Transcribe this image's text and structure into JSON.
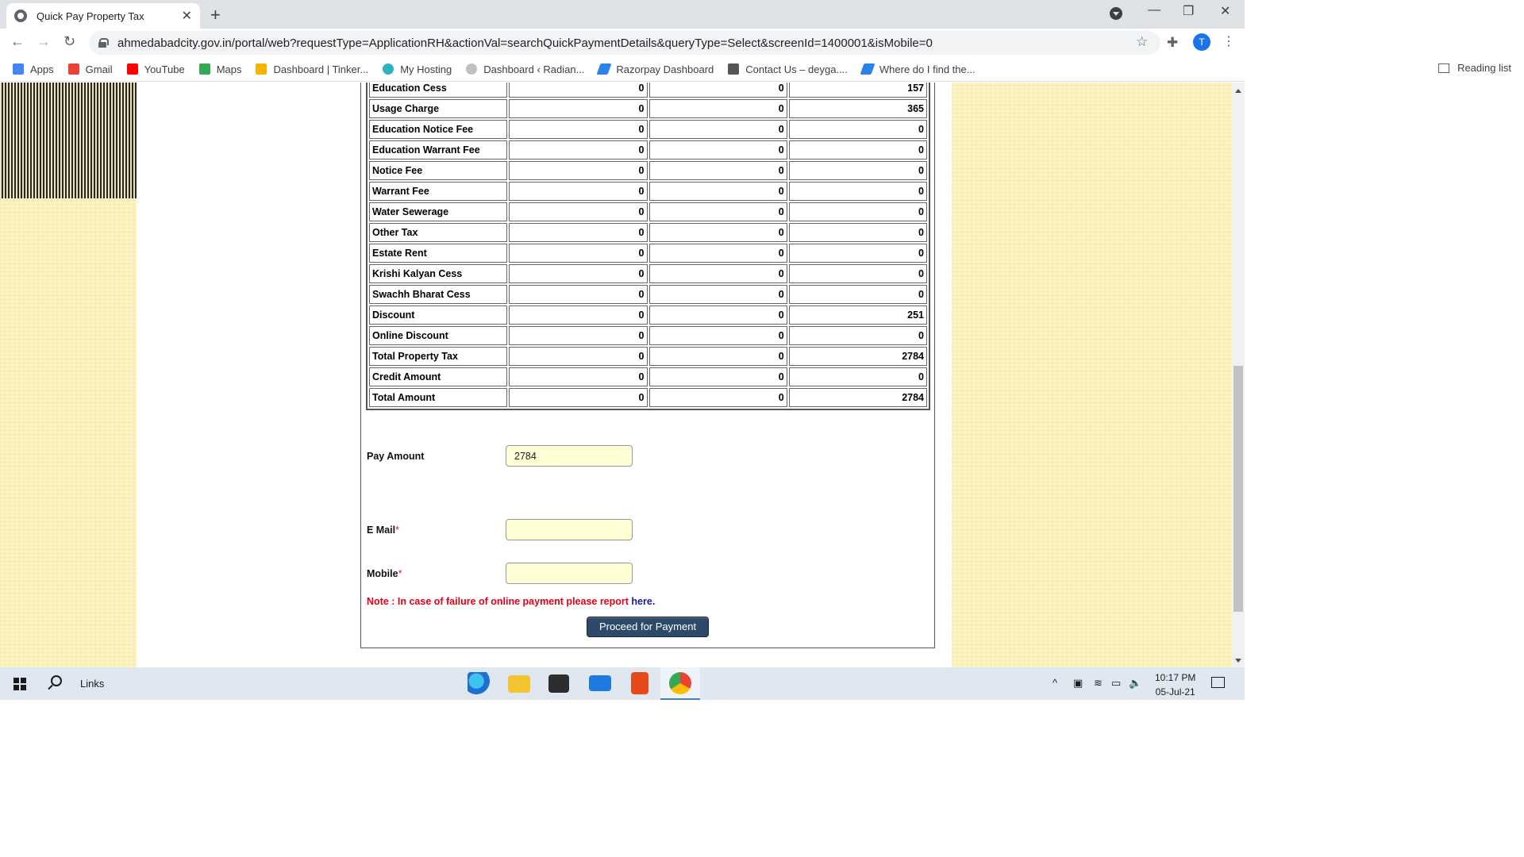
{
  "browser": {
    "tab_title": "Quick Pay Property Tax",
    "url": "ahmedabadcity.gov.in/portal/web?requestType=ApplicationRH&actionVal=searchQuickPaymentDetails&queryType=Select&screenId=1400001&isMobile=0",
    "profile_initial": "T",
    "bookmarks": [
      {
        "label": "Apps",
        "icon": "apps-grid-icon",
        "color": "#4285f4"
      },
      {
        "label": "Gmail",
        "icon": "gmail-icon",
        "color": "#ea4335"
      },
      {
        "label": "YouTube",
        "icon": "youtube-icon",
        "color": "#ff0000"
      },
      {
        "label": "Maps",
        "icon": "maps-icon",
        "color": "#34a853"
      },
      {
        "label": "Dashboard | Tinker...",
        "icon": "tinker-icon",
        "color": "#f4b400"
      },
      {
        "label": "My Hosting",
        "icon": "hosting-icon",
        "color": "#2bb3c0"
      },
      {
        "label": "Dashboard ‹ Radian...",
        "icon": "radian-icon",
        "color": "#c0c0c0"
      },
      {
        "label": "Razorpay Dashboard",
        "icon": "razorpay-icon",
        "color": "#2b83ea"
      },
      {
        "label": "Contact Us – deyga....",
        "icon": "deyga-icon",
        "color": "#555555"
      },
      {
        "label": "Where do I find the...",
        "icon": "razorpay-icon",
        "color": "#2b83ea"
      }
    ],
    "reading_list": "Reading list"
  },
  "tax_table": {
    "rows": [
      {
        "label": "Education Cess",
        "c1": "0",
        "c2": "0",
        "c3": "157"
      },
      {
        "label": "Usage Charge",
        "c1": "0",
        "c2": "0",
        "c3": "365"
      },
      {
        "label": "Education Notice Fee",
        "c1": "0",
        "c2": "0",
        "c3": "0"
      },
      {
        "label": "Education Warrant Fee",
        "c1": "0",
        "c2": "0",
        "c3": "0"
      },
      {
        "label": "Notice Fee",
        "c1": "0",
        "c2": "0",
        "c3": "0"
      },
      {
        "label": "Warrant Fee",
        "c1": "0",
        "c2": "0",
        "c3": "0"
      },
      {
        "label": "Water Sewerage",
        "c1": "0",
        "c2": "0",
        "c3": "0"
      },
      {
        "label": "Other Tax",
        "c1": "0",
        "c2": "0",
        "c3": "0"
      },
      {
        "label": "Estate Rent",
        "c1": "0",
        "c2": "0",
        "c3": "0"
      },
      {
        "label": "Krishi Kalyan Cess",
        "c1": "0",
        "c2": "0",
        "c3": "0"
      },
      {
        "label": "Swachh Bharat Cess",
        "c1": "0",
        "c2": "0",
        "c3": "0"
      },
      {
        "label": "Discount",
        "c1": "0",
        "c2": "0",
        "c3": "251"
      },
      {
        "label": "Online Discount",
        "c1": "0",
        "c2": "0",
        "c3": "0"
      },
      {
        "label": "Total Property Tax",
        "c1": "0",
        "c2": "0",
        "c3": "2784"
      },
      {
        "label": "Credit Amount",
        "c1": "0",
        "c2": "0",
        "c3": "0"
      },
      {
        "label": "Total Amount",
        "c1": "0",
        "c2": "0",
        "c3": "2784"
      }
    ]
  },
  "form": {
    "pay_amount_label": "Pay Amount",
    "pay_amount_value": "2784",
    "email_label": "E Mail",
    "mobile_label": "Mobile",
    "required_mark": "*",
    "email_value": "",
    "mobile_value": "",
    "note_text": "Note : In case of failure of online payment please report ",
    "note_link": "here",
    "note_end": ".",
    "proceed_label": "Proceed for Payment"
  },
  "taskbar": {
    "links_label": "Links",
    "time": "10:17 PM",
    "date": "05-Jul-21"
  }
}
